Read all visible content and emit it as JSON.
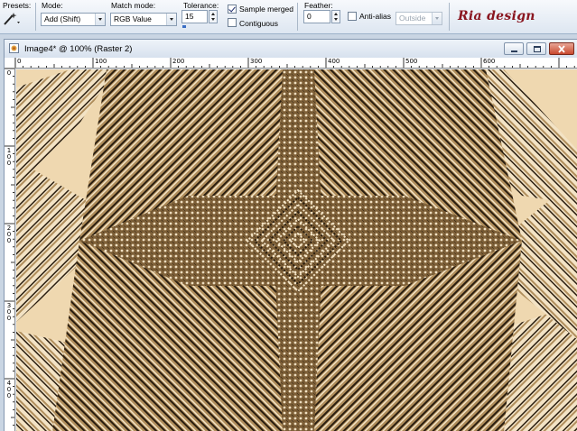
{
  "toolbar": {
    "presets_label": "Presets:",
    "mode_label": "Mode:",
    "mode_value": "Add (Shift)",
    "match_mode_label": "Match mode:",
    "match_mode_value": "RGB Value",
    "tolerance_label": "Tolerance:",
    "tolerance_value": "15",
    "sample_merged_label": "Sample merged",
    "sample_merged_checked": true,
    "contiguous_label": "Contiguous",
    "contiguous_checked": false,
    "feather_label": "Feather:",
    "feather_value": "0",
    "anti_alias_label": "Anti-alias",
    "anti_alias_checked": false,
    "anti_alias_mode_value": "Outside",
    "brand_text": "Ria design"
  },
  "document": {
    "title": "Image4* @ 100% (Raster 2)",
    "icon": "image-document-icon",
    "window_controls": [
      "minimize-icon",
      "restore-icon",
      "close-icon"
    ]
  },
  "ruler_top": [
    "0",
    "100",
    "200",
    "300",
    "400",
    "500",
    "600"
  ],
  "ruler_left": [
    "0",
    "100",
    "200",
    "300",
    "400"
  ],
  "canvas": {
    "colors": {
      "background": "#efd8b0",
      "tan": "#b08e5c",
      "brown": "#7a5c34",
      "dark": "#2a1e10",
      "cream": "#f3e3c5",
      "white": "#ffffff"
    }
  }
}
